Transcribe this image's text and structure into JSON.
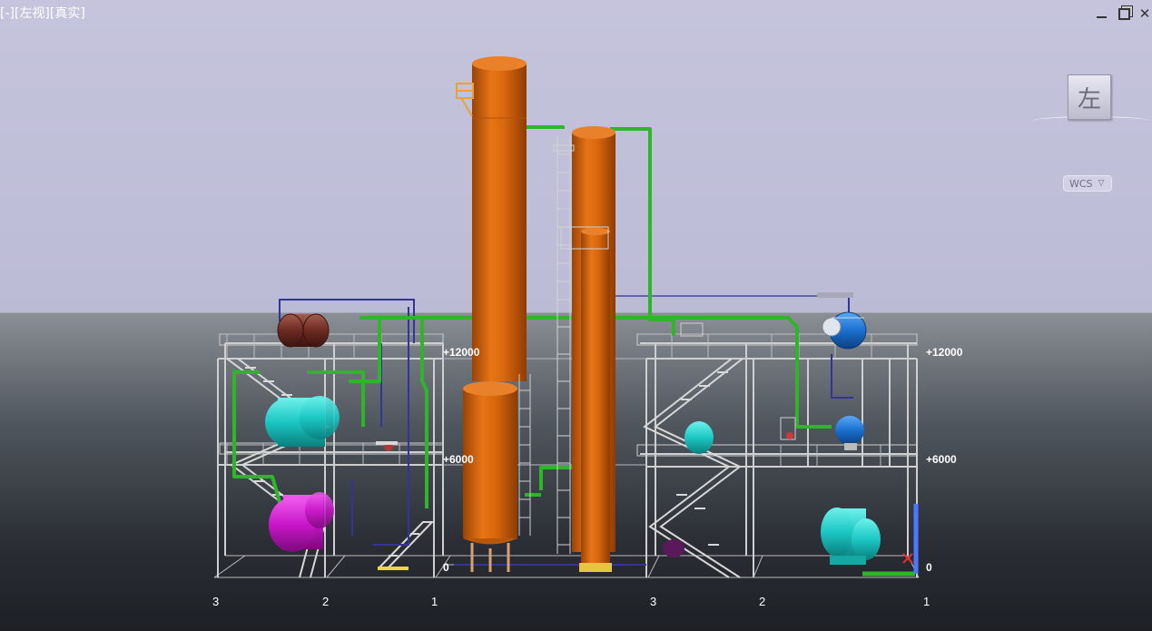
{
  "viewport": {
    "label": "[-][左视][真实]",
    "view_cube_face": "左",
    "coord_system": "WCS"
  },
  "window_controls": {
    "minimize": "minimize-icon",
    "restore": "restore-icon",
    "close": "close-icon"
  },
  "elevations": {
    "left": [
      "+12000",
      "+6000",
      "0"
    ],
    "right": [
      "+12000",
      "+6000",
      "0"
    ]
  },
  "grid_axes": {
    "left": [
      "3",
      "2",
      "1"
    ],
    "right": [
      "3",
      "2",
      "1"
    ]
  },
  "colors": {
    "column": "#d4630a",
    "pipe_green": "#2fb52a",
    "pipe_blue": "#33339a",
    "vessel_cyan": "#1bc7c3",
    "vessel_magenta": "#c816c8",
    "vessel_blue": "#1a6fd0",
    "vessel_brown": "#6b2a22",
    "steel": "#c8c8c8"
  }
}
